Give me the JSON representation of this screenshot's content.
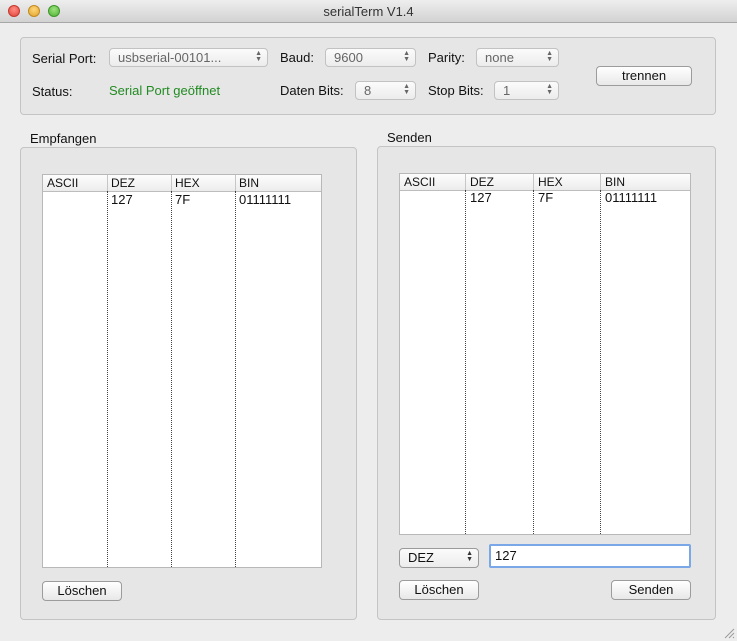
{
  "window": {
    "title": "serialTerm V1.4"
  },
  "settings": {
    "serial_port_label": "Serial Port:",
    "serial_port_value": "usbserial-00101...",
    "status_label": "Status:",
    "status_value": "Serial Port geöffnet",
    "status_color": "#228b22",
    "baud_label": "Baud:",
    "baud_value": "9600",
    "databits_label": "Daten Bits:",
    "databits_value": "8",
    "parity_label": "Parity:",
    "parity_value": "none",
    "stopbits_label": "Stop Bits:",
    "stopbits_value": "1",
    "disconnect_label": "trennen"
  },
  "receive": {
    "title": "Empfangen",
    "columns": [
      "ASCII",
      "DEZ",
      "HEX",
      "BIN"
    ],
    "rows": [
      {
        "ascii": "",
        "dez": "127",
        "hex": "7F",
        "bin": "01111111"
      }
    ],
    "clear_label": "Löschen"
  },
  "send": {
    "title": "Senden",
    "columns": [
      "ASCII",
      "DEZ",
      "HEX",
      "BIN"
    ],
    "rows": [
      {
        "ascii": "",
        "dez": "127",
        "hex": "7F",
        "bin": "01111111"
      }
    ],
    "format_value": "DEZ",
    "input_value": "127",
    "clear_label": "Löschen",
    "send_label": "Senden"
  }
}
